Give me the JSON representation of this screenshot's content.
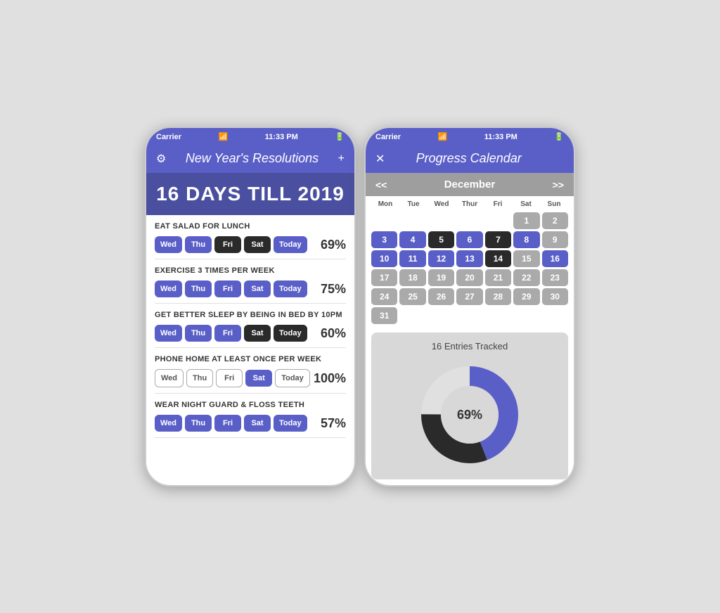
{
  "left_phone": {
    "status_bar": {
      "carrier": "Carrier",
      "time": "11:33 PM",
      "battery": "■"
    },
    "header": {
      "title": "New Year's Resolutions",
      "settings_icon": "⚙",
      "add_icon": "+"
    },
    "countdown": "16 DAYS TILL 2019",
    "resolutions": [
      {
        "title": "EAT SALAD FOR LUNCH",
        "days": [
          {
            "label": "Wed",
            "style": "blue"
          },
          {
            "label": "Thu",
            "style": "blue"
          },
          {
            "label": "Fri",
            "style": "dark"
          },
          {
            "label": "Sat",
            "style": "dark"
          },
          {
            "label": "Today",
            "style": "blue"
          }
        ],
        "percentage": "69%"
      },
      {
        "title": "EXERCISE 3 TIMES PER WEEK",
        "days": [
          {
            "label": "Wed",
            "style": "blue"
          },
          {
            "label": "Thu",
            "style": "blue"
          },
          {
            "label": "Fri",
            "style": "blue"
          },
          {
            "label": "Sat",
            "style": "blue"
          },
          {
            "label": "Today",
            "style": "blue"
          }
        ],
        "percentage": "75%"
      },
      {
        "title": "GET BETTER SLEEP BY BEING IN BED BY 10PM",
        "days": [
          {
            "label": "Wed",
            "style": "blue"
          },
          {
            "label": "Thu",
            "style": "blue"
          },
          {
            "label": "Fri",
            "style": "blue"
          },
          {
            "label": "Sat",
            "style": "dark"
          },
          {
            "label": "Today",
            "style": "dark"
          }
        ],
        "percentage": "60%"
      },
      {
        "title": "PHONE HOME AT LEAST ONCE PER WEEK",
        "days": [
          {
            "label": "Wed",
            "style": "outline"
          },
          {
            "label": "Thu",
            "style": "outline"
          },
          {
            "label": "Fri",
            "style": "outline"
          },
          {
            "label": "Sat",
            "style": "blue"
          },
          {
            "label": "Today",
            "style": "outline"
          }
        ],
        "percentage": "100%"
      },
      {
        "title": "WEAR NIGHT GUARD & FLOSS TEETH",
        "days": [
          {
            "label": "Wed",
            "style": "blue"
          },
          {
            "label": "Thu",
            "style": "blue"
          },
          {
            "label": "Fri",
            "style": "blue"
          },
          {
            "label": "Sat",
            "style": "blue"
          },
          {
            "label": "Today",
            "style": "blue"
          }
        ],
        "percentage": "57%"
      }
    ]
  },
  "right_phone": {
    "status_bar": {
      "carrier": "Carrier",
      "time": "11:33 PM",
      "battery": "■"
    },
    "header": {
      "title": "Progress Calendar",
      "close_icon": "✕"
    },
    "calendar": {
      "month": "December",
      "prev": "<<",
      "next": ">>",
      "weekdays": [
        "Mon",
        "Tue",
        "Wed",
        "Thur",
        "Fri",
        "Sat",
        "Sun"
      ],
      "cells": [
        {
          "day": "",
          "style": "empty"
        },
        {
          "day": "",
          "style": "empty"
        },
        {
          "day": "",
          "style": "empty"
        },
        {
          "day": "",
          "style": "empty"
        },
        {
          "day": "",
          "style": "empty"
        },
        {
          "day": "1",
          "style": "gray"
        },
        {
          "day": "2",
          "style": "gray"
        },
        {
          "day": "3",
          "style": "blue"
        },
        {
          "day": "4",
          "style": "blue"
        },
        {
          "day": "5",
          "style": "dark"
        },
        {
          "day": "6",
          "style": "blue"
        },
        {
          "day": "7",
          "style": "dark"
        },
        {
          "day": "8",
          "style": "blue"
        },
        {
          "day": "9",
          "style": "gray"
        },
        {
          "day": "10",
          "style": "blue"
        },
        {
          "day": "11",
          "style": "blue"
        },
        {
          "day": "12",
          "style": "blue"
        },
        {
          "day": "13",
          "style": "blue"
        },
        {
          "day": "14",
          "style": "dark"
        },
        {
          "day": "15",
          "style": "gray"
        },
        {
          "day": "16",
          "style": "blue"
        },
        {
          "day": "17",
          "style": "gray"
        },
        {
          "day": "18",
          "style": "gray"
        },
        {
          "day": "19",
          "style": "gray"
        },
        {
          "day": "20",
          "style": "gray"
        },
        {
          "day": "21",
          "style": "gray"
        },
        {
          "day": "22",
          "style": "gray"
        },
        {
          "day": "23",
          "style": "gray"
        },
        {
          "day": "24",
          "style": "gray"
        },
        {
          "day": "25",
          "style": "gray"
        },
        {
          "day": "26",
          "style": "gray"
        },
        {
          "day": "27",
          "style": "gray"
        },
        {
          "day": "28",
          "style": "gray"
        },
        {
          "day": "29",
          "style": "gray"
        },
        {
          "day": "30",
          "style": "gray"
        },
        {
          "day": "31",
          "style": "gray"
        },
        {
          "day": "",
          "style": "empty"
        },
        {
          "day": "",
          "style": "empty"
        },
        {
          "day": "",
          "style": "empty"
        },
        {
          "day": "",
          "style": "empty"
        },
        {
          "day": "",
          "style": "empty"
        },
        {
          "day": "",
          "style": "empty"
        }
      ]
    },
    "stats": {
      "entries_tracked": "16 Entries Tracked",
      "percentage": "69%",
      "donut": {
        "blue_percent": 69,
        "dark_percent": 31
      }
    }
  }
}
